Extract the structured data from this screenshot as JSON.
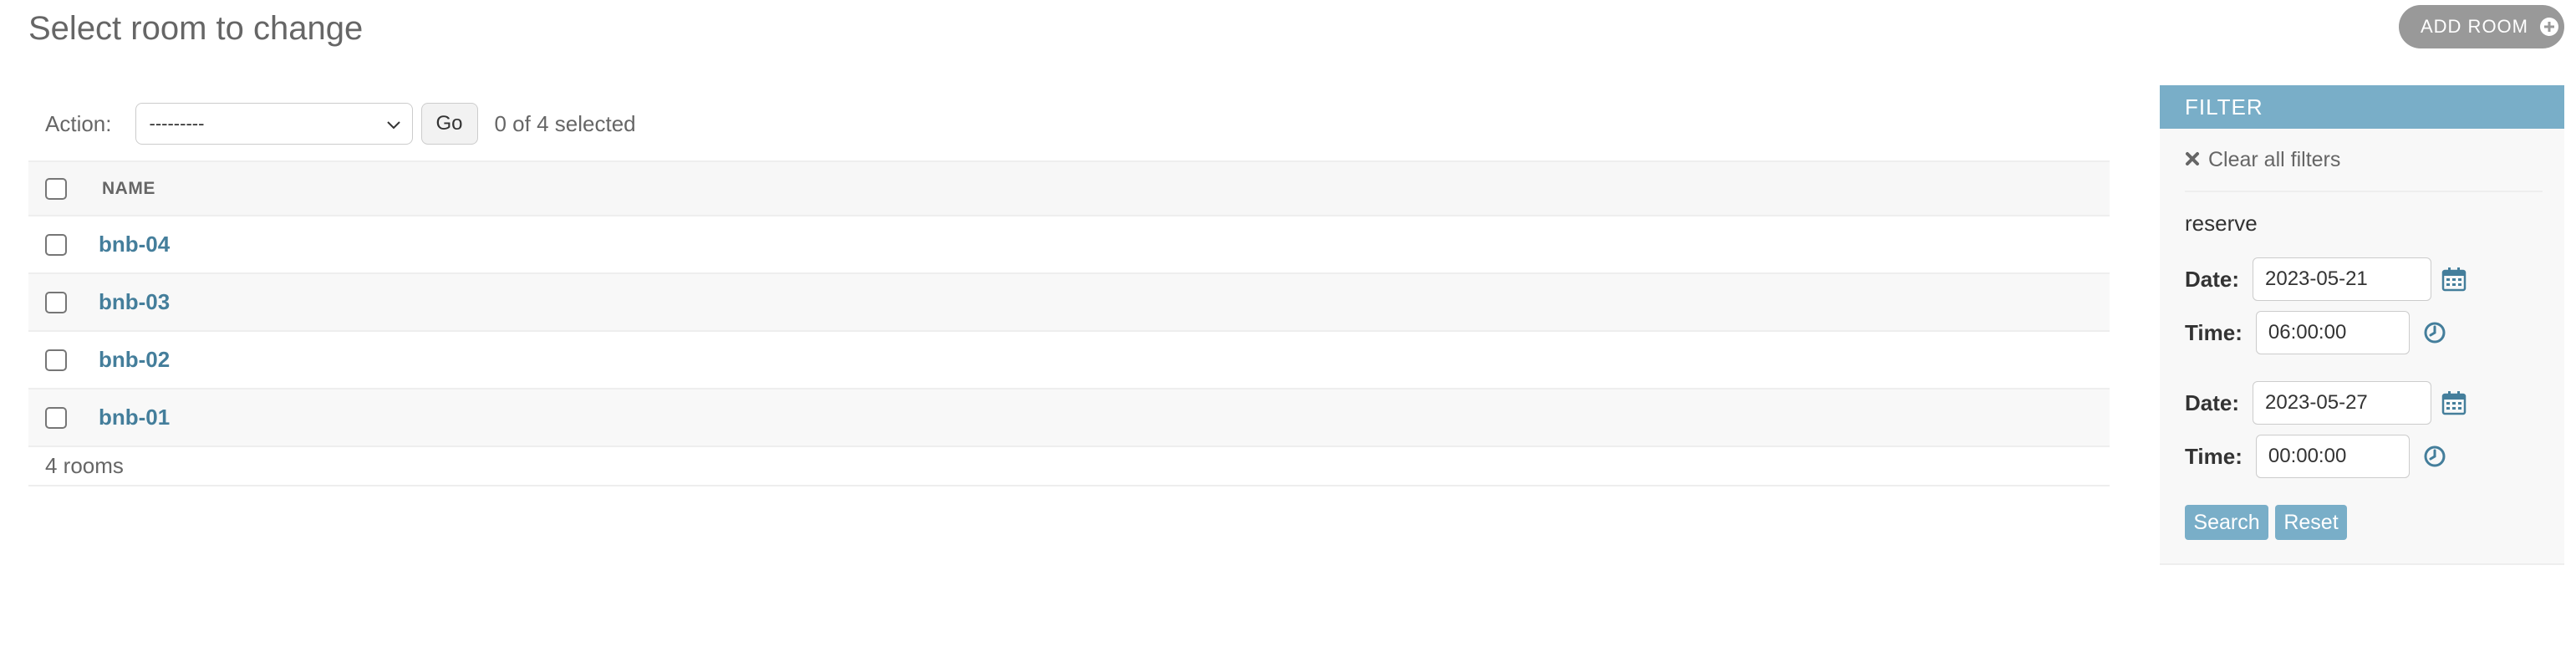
{
  "header": {
    "title": "Select room to change",
    "add_button_label": "ADD ROOM"
  },
  "actions": {
    "label": "Action:",
    "selected_option": "---------",
    "go_label": "Go",
    "selection_status": "0 of 4 selected"
  },
  "table": {
    "column_name": "NAME",
    "rows": [
      {
        "name": "bnb-04"
      },
      {
        "name": "bnb-03"
      },
      {
        "name": "bnb-02"
      },
      {
        "name": "bnb-01"
      }
    ],
    "result_count": "4 rooms"
  },
  "filter": {
    "header": "FILTER",
    "clear_label": "Clear all filters",
    "group_title": "reserve",
    "date_label": "Date:",
    "time_label": "Time:",
    "start_date": "2023-05-21",
    "start_time": "06:00:00",
    "end_date": "2023-05-27",
    "end_time": "00:00:00",
    "search_label": "Search",
    "reset_label": "Reset"
  },
  "colors": {
    "link": "#447e9b",
    "filter_header": "#79aec8",
    "add_button": "#999999"
  }
}
